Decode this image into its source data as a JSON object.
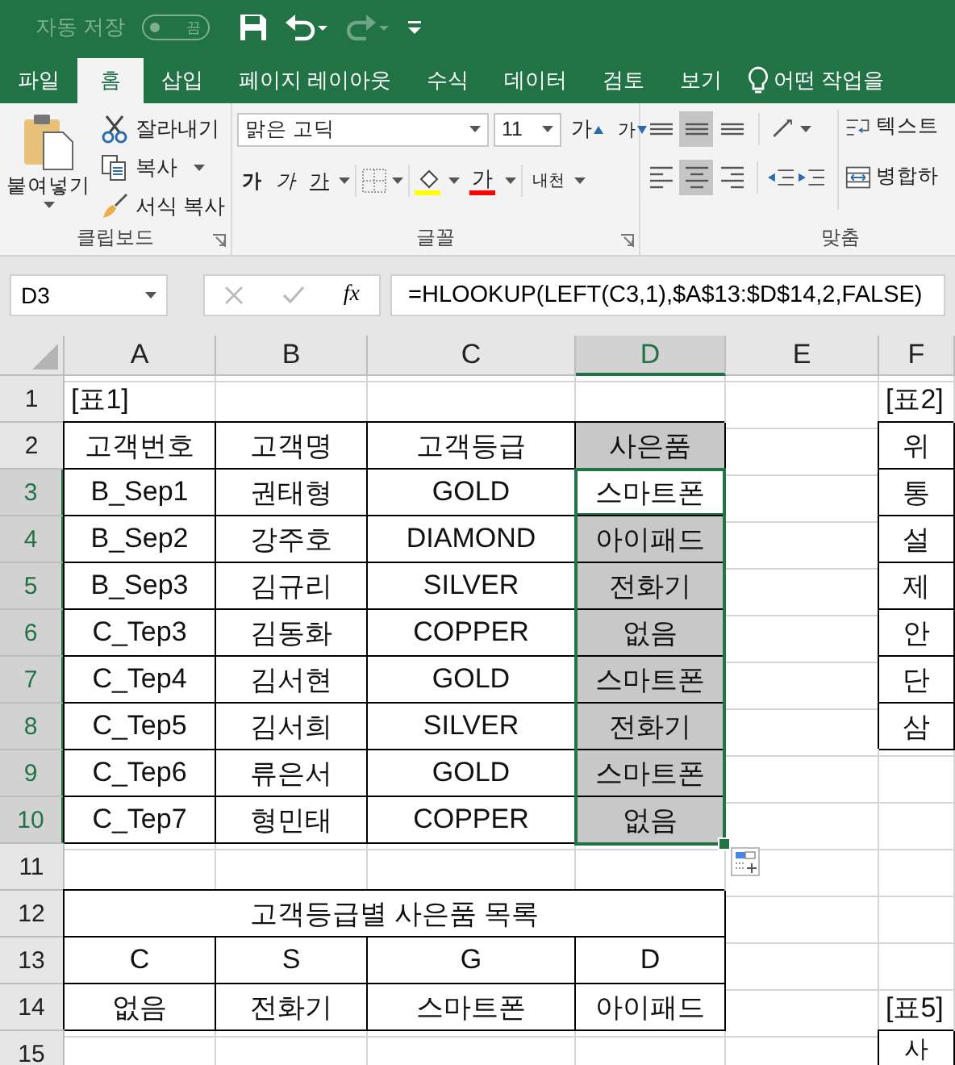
{
  "title_bar": {
    "autosave_label": "자동 저장",
    "autosave": {
      "on": false,
      "label": "끔"
    },
    "redo_disabled": true
  },
  "tabs": [
    {
      "label": "파일",
      "selected": false
    },
    {
      "label": "홈",
      "selected": true
    },
    {
      "label": "삽입",
      "selected": false
    },
    {
      "label": "페이지 레이아웃",
      "selected": false
    },
    {
      "label": "수식",
      "selected": false
    },
    {
      "label": "데이터",
      "selected": false
    },
    {
      "label": "검토",
      "selected": false
    },
    {
      "label": "보기",
      "selected": false
    }
  ],
  "tell_me": "어떤 작업을",
  "ribbon": {
    "clipboard": {
      "label": "클립보드",
      "paste": "붙여넣기",
      "items": [
        {
          "kind": "cut",
          "label": "잘라내기"
        },
        {
          "kind": "copy",
          "label": "복사"
        },
        {
          "kind": "painter",
          "label": "서식 복사"
        }
      ]
    },
    "font": {
      "label": "글꼴",
      "font_name": "맑은 고딕",
      "font_size": "11",
      "size_buttons": [
        {
          "kind": "grow",
          "label": "가"
        },
        {
          "kind": "shrink",
          "label": "가"
        }
      ],
      "style_buttons": [
        {
          "kind": "bold",
          "label": "가"
        },
        {
          "kind": "italic",
          "label": "가"
        },
        {
          "kind": "underline",
          "label": "가"
        }
      ],
      "font_color_label": "가",
      "phonetic": "내천"
    },
    "alignment": {
      "label": "맞춤",
      "buttons": [
        {
          "kind": "top",
          "selected": false
        },
        {
          "kind": "middle",
          "selected": true
        },
        {
          "kind": "bottom",
          "selected": false
        },
        {
          "kind": "left",
          "selected": false
        },
        {
          "kind": "center",
          "selected": true
        },
        {
          "kind": "right",
          "selected": false
        }
      ],
      "wrap_text": "텍스트",
      "merge": "병합하"
    }
  },
  "formula_bar": {
    "name_box": "D3",
    "fx": "fx",
    "formula": "=HLOOKUP(LEFT(C3,1),$A$13:$D$14,2,FALSE)"
  },
  "sheet": {
    "columns": [
      {
        "label": "A",
        "selected": false
      },
      {
        "label": "B",
        "selected": false
      },
      {
        "label": "C",
        "selected": false
      },
      {
        "label": "D",
        "selected": true
      },
      {
        "label": "E",
        "selected": false
      },
      {
        "label": "F",
        "selected": false
      }
    ],
    "rows": [
      {
        "label": "1",
        "selected": false,
        "cells": [
          {
            "text": "[표1]",
            "kind": "label",
            "selected": false
          },
          {
            "text": "",
            "kind": "empty"
          },
          {
            "text": "",
            "kind": "empty"
          },
          {
            "text": "",
            "kind": "empty"
          },
          {
            "text": "",
            "kind": "empty"
          },
          {
            "text": "[표2]",
            "kind": "label",
            "selected": false
          }
        ]
      },
      {
        "label": "2",
        "selected": false,
        "cells": [
          {
            "text": "고객번호",
            "kind": "boxed",
            "selected": false
          },
          {
            "text": "고객명",
            "kind": "boxed",
            "selected": false
          },
          {
            "text": "고객등급",
            "kind": "boxed",
            "selected": false
          },
          {
            "text": "사은품",
            "kind": "header",
            "selected": false
          },
          {
            "text": "",
            "kind": "empty"
          },
          {
            "text": "위",
            "kind": "boxed",
            "selected": false
          }
        ]
      },
      {
        "label": "3",
        "selected": true,
        "cells": [
          {
            "text": "B_Sep1",
            "kind": "boxed",
            "selected": false
          },
          {
            "text": "권태형",
            "kind": "boxed",
            "selected": false
          },
          {
            "text": "GOLD",
            "kind": "boxed",
            "selected": false
          },
          {
            "text": "스마트폰",
            "kind": "boxed",
            "selected": true,
            "active": true
          },
          {
            "text": "",
            "kind": "empty"
          },
          {
            "text": "통",
            "kind": "boxed",
            "selected": false
          }
        ]
      },
      {
        "label": "4",
        "selected": true,
        "cells": [
          {
            "text": "B_Sep2",
            "kind": "boxed",
            "selected": false
          },
          {
            "text": "강주호",
            "kind": "boxed",
            "selected": false
          },
          {
            "text": "DIAMOND",
            "kind": "boxed",
            "selected": false
          },
          {
            "text": "아이패드",
            "kind": "boxed",
            "selected": true
          },
          {
            "text": "",
            "kind": "empty"
          },
          {
            "text": "설",
            "kind": "boxed",
            "selected": false
          }
        ]
      },
      {
        "label": "5",
        "selected": true,
        "cells": [
          {
            "text": "B_Sep3",
            "kind": "boxed",
            "selected": false
          },
          {
            "text": "김규리",
            "kind": "boxed",
            "selected": false
          },
          {
            "text": "SILVER",
            "kind": "boxed",
            "selected": false
          },
          {
            "text": "전화기",
            "kind": "boxed",
            "selected": true
          },
          {
            "text": "",
            "kind": "empty"
          },
          {
            "text": "제",
            "kind": "boxed",
            "selected": false
          }
        ]
      },
      {
        "label": "6",
        "selected": true,
        "cells": [
          {
            "text": "C_Tep3",
            "kind": "boxed",
            "selected": false
          },
          {
            "text": "김동화",
            "kind": "boxed",
            "selected": false
          },
          {
            "text": "COPPER",
            "kind": "boxed",
            "selected": false
          },
          {
            "text": "없음",
            "kind": "boxed",
            "selected": true
          },
          {
            "text": "",
            "kind": "empty"
          },
          {
            "text": "안",
            "kind": "boxed",
            "selected": false
          }
        ]
      },
      {
        "label": "7",
        "selected": true,
        "cells": [
          {
            "text": "C_Tep4",
            "kind": "boxed",
            "selected": false
          },
          {
            "text": "김서현",
            "kind": "boxed",
            "selected": false
          },
          {
            "text": "GOLD",
            "kind": "boxed",
            "selected": false
          },
          {
            "text": "스마트폰",
            "kind": "boxed",
            "selected": true
          },
          {
            "text": "",
            "kind": "empty"
          },
          {
            "text": "단",
            "kind": "boxed",
            "selected": false
          }
        ]
      },
      {
        "label": "8",
        "selected": true,
        "cells": [
          {
            "text": "C_Tep5",
            "kind": "boxed",
            "selected": false
          },
          {
            "text": "김서희",
            "kind": "boxed",
            "selected": false
          },
          {
            "text": "SILVER",
            "kind": "boxed",
            "selected": false
          },
          {
            "text": "전화기",
            "kind": "boxed",
            "selected": true
          },
          {
            "text": "",
            "kind": "empty"
          },
          {
            "text": "삼",
            "kind": "boxed",
            "selected": false
          }
        ]
      },
      {
        "label": "9",
        "selected": true,
        "cells": [
          {
            "text": "C_Tep6",
            "kind": "boxed",
            "selected": false
          },
          {
            "text": "류은서",
            "kind": "boxed",
            "selected": false
          },
          {
            "text": "GOLD",
            "kind": "boxed",
            "selected": false
          },
          {
            "text": "스마트폰",
            "kind": "boxed",
            "selected": true
          }
        ]
      },
      {
        "label": "10",
        "selected": true,
        "cells": [
          {
            "text": "C_Tep7",
            "kind": "boxed",
            "selected": false
          },
          {
            "text": "형민태",
            "kind": "boxed",
            "selected": false
          },
          {
            "text": "COPPER",
            "kind": "boxed",
            "selected": false
          },
          {
            "text": "없음",
            "kind": "boxed",
            "selected": true
          }
        ]
      },
      {
        "label": "11",
        "selected": false
      },
      {
        "label": "12",
        "selected": false,
        "cells": [
          {
            "text": "고객등급별 사은품 목록",
            "kind": "boxed",
            "selected": false,
            "colspan": 4
          }
        ]
      },
      {
        "label": "13",
        "selected": false,
        "cells": [
          {
            "text": "C",
            "kind": "boxed",
            "selected": false
          },
          {
            "text": "S",
            "kind": "boxed",
            "selected": false
          },
          {
            "text": "G",
            "kind": "boxed",
            "selected": false
          },
          {
            "text": "D",
            "kind": "boxed",
            "selected": false
          }
        ]
      },
      {
        "label": "14",
        "selected": false,
        "cells": [
          {
            "text": "없음",
            "kind": "boxed",
            "selected": false
          },
          {
            "text": "전화기",
            "kind": "boxed",
            "selected": false
          },
          {
            "text": "스마트폰",
            "kind": "boxed",
            "selected": false
          },
          {
            "text": "아이패드",
            "kind": "boxed",
            "selected": false
          },
          {
            "text": "",
            "kind": "empty"
          },
          {
            "text": "[표5]",
            "kind": "label",
            "selected": false
          }
        ]
      },
      {
        "label": "15",
        "selected": false,
        "cells": [
          {
            "text": "",
            "kind": "empty"
          },
          {
            "text": "",
            "kind": "empty"
          },
          {
            "text": "",
            "kind": "empty"
          },
          {
            "text": "",
            "kind": "empty"
          },
          {
            "text": "",
            "kind": "empty"
          },
          {
            "text": "사",
            "kind": "boxed",
            "selected": false
          }
        ]
      }
    ]
  }
}
